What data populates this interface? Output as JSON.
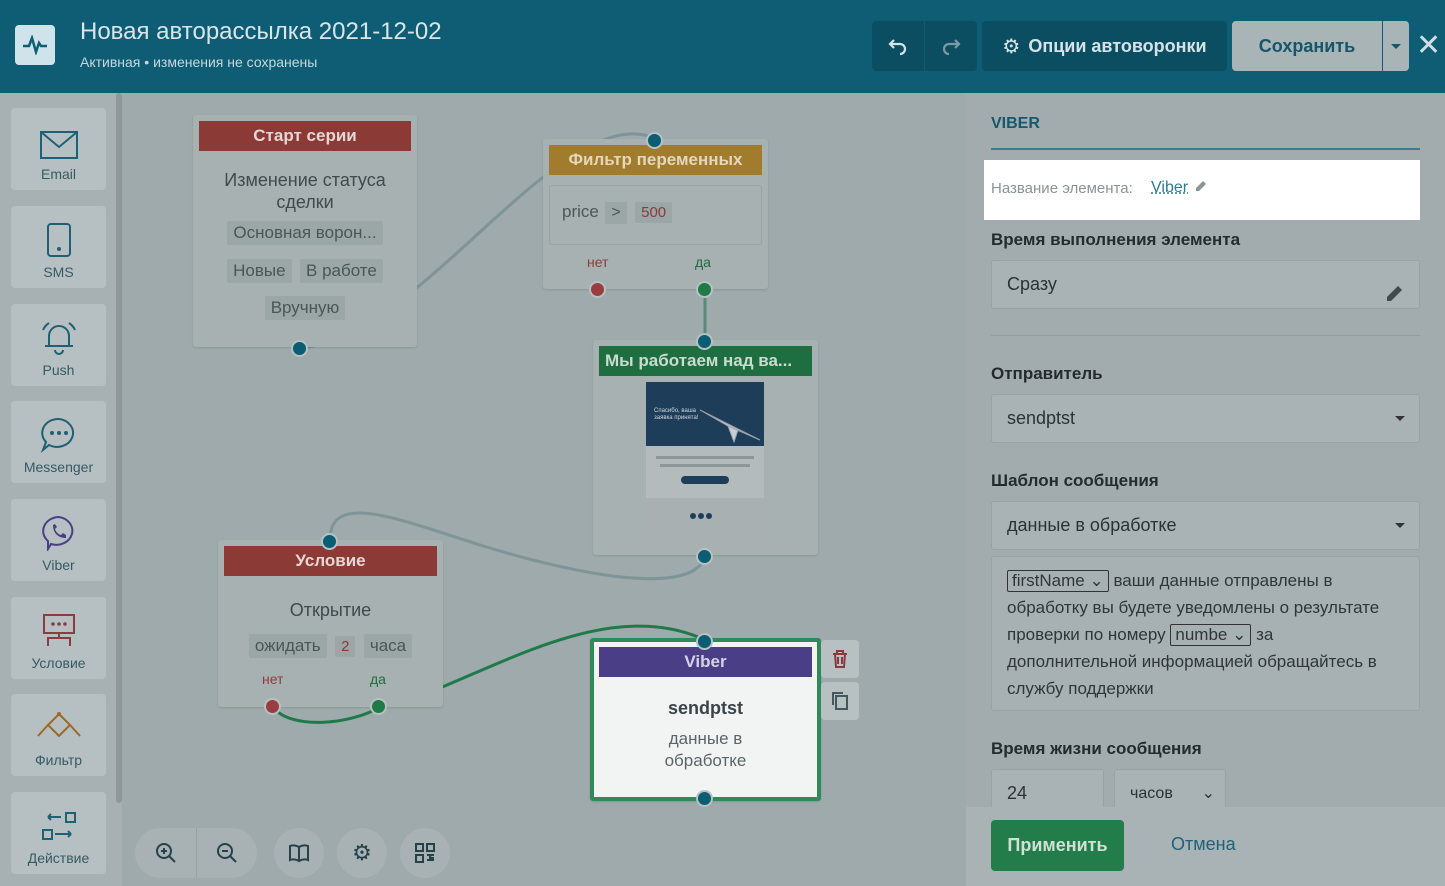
{
  "header": {
    "title": "Новая авторассылка 2021-12-02",
    "status": "Активная",
    "status_note": "изменения не сохранены",
    "options_label": "Опции автоворонки",
    "save_label": "Сохранить"
  },
  "toolbar": {
    "items": [
      {
        "label": "Email",
        "icon": "envelope-icon"
      },
      {
        "label": "SMS",
        "icon": "phone-icon"
      },
      {
        "label": "Push",
        "icon": "bell-icon"
      },
      {
        "label": "Messenger",
        "icon": "chat-icon"
      },
      {
        "label": "Viber",
        "icon": "viber-icon"
      },
      {
        "label": "Условие",
        "icon": "condition-icon"
      },
      {
        "label": "Фильтр",
        "icon": "filter-icon"
      },
      {
        "label": "Действие",
        "icon": "action-icon"
      }
    ]
  },
  "canvas": {
    "start": {
      "title": "Старт серии",
      "subtitle": "Изменение статуса сделки",
      "funnel": "Основная ворон...",
      "stage_from": "Новые",
      "stage_to": "В работе",
      "mode": "Вручную"
    },
    "filter": {
      "title": "Фильтр переменных",
      "var": "price",
      "op": ">",
      "value": "500",
      "no": "нет",
      "yes": "да"
    },
    "email": {
      "title": "Мы работаем над ва...",
      "preview_text": "Спасибо, ваша заявка принята!"
    },
    "condition": {
      "title": "Условие",
      "subtitle": "Открытие",
      "wait": "ожидать",
      "num": "2",
      "unit": "часа",
      "no": "нет",
      "yes": "да"
    },
    "viber": {
      "title": "Viber",
      "sender": "sendptst",
      "template": "данные в обработке"
    }
  },
  "panel": {
    "tab": "VIBER",
    "name_label": "Название элемента:",
    "name_value": "Viber",
    "exec_time_label": "Время выполнения элемента",
    "exec_time_value": "Сразу",
    "sender_label": "Отправитель",
    "sender_value": "sendptst",
    "template_label": "Шаблон сообщения",
    "template_value": "данные в обработке",
    "template_var1": "firstName",
    "template_text1": "ваши данные отправлены в обработку вы будете уведомлены о результате проверки по номеру",
    "template_var2": "numbe",
    "template_text2": "за дополнительной информацией обращайтесь в службу поддержки",
    "ttl_label": "Время жизни сообщения",
    "ttl_value": "24",
    "ttl_unit": "часов",
    "apply_label": "Применить",
    "cancel_label": "Отмена"
  }
}
